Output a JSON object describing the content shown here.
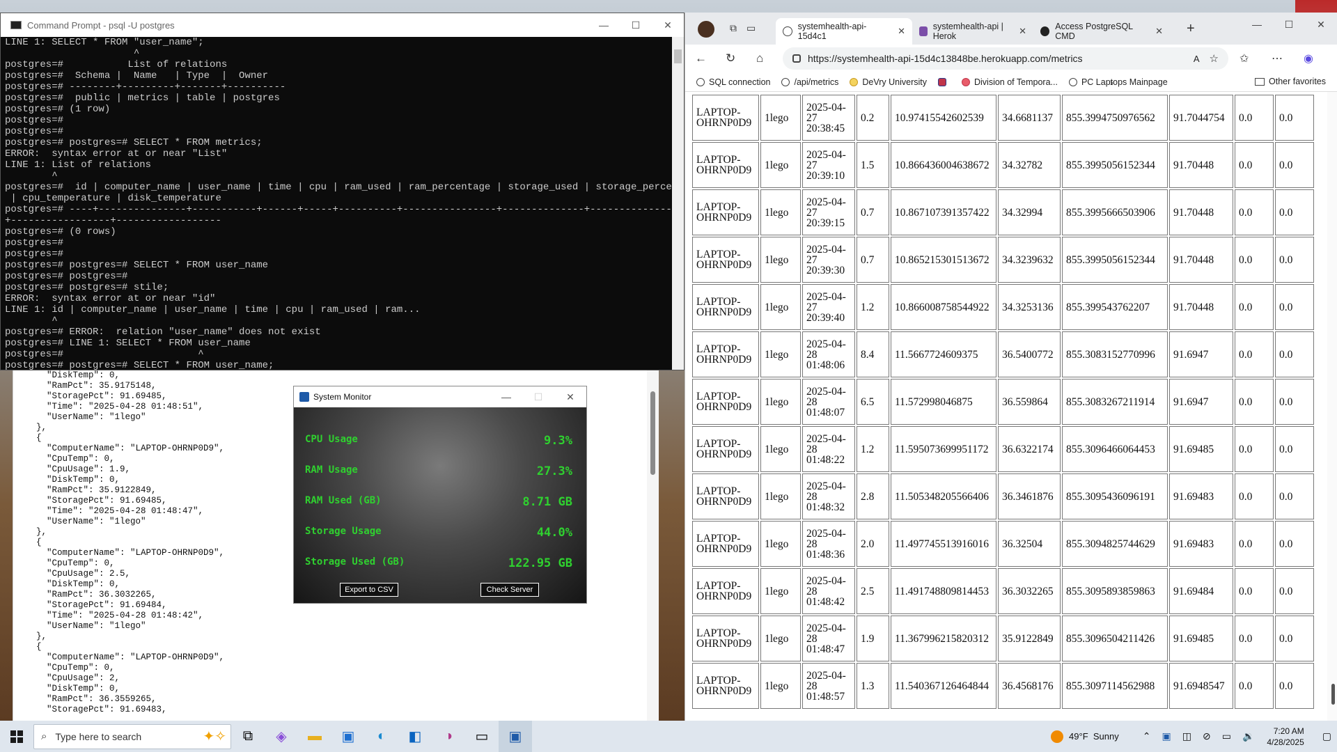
{
  "cmd": {
    "title": "Command Prompt - psql  -U postgres",
    "lines": [
      "LINE 1: SELECT * FROM \"user_name\";",
      "                      ^",
      "postgres=#           List of relations",
      "postgres=#  Schema |  Name   | Type  |  Owner",
      "postgres=# --------+---------+-------+----------",
      "postgres=#  public | metrics | table | postgres",
      "postgres=# (1 row)",
      "postgres=#",
      "postgres=#",
      "postgres=# postgres=# SELECT * FROM metrics;",
      "ERROR:  syntax error at or near \"List\"",
      "LINE 1: List of relations",
      "        ^",
      "postgres=#  id | computer_name | user_name | time | cpu | ram_used | ram_percentage | storage_used | storage_percentage",
      " | cpu_temperature | disk_temperature",
      "postgres=# ----+---------------+-----------+------+-----+----------+----------------+--------------+--------------------",
      "+-----------------+------------------",
      "postgres=# (0 rows)",
      "postgres=#",
      "postgres=#",
      "postgres=# postgres=# SELECT * FROM user_name",
      "postgres=# postgres=#",
      "postgres=# postgres=# stile;",
      "ERROR:  syntax error at or near \"id\"",
      "LINE 1: id | computer_name | user_name | time | cpu | ram_used | ram...",
      "        ^",
      "postgres=# ERROR:  relation \"user_name\" does not exist",
      "postgres=# LINE 1: SELECT * FROM user_name",
      "postgres=#                       ^",
      "postgres=# postgres=# SELECT * FROM user_name;"
    ]
  },
  "json_viewer": {
    "lines": [
      "    \"DiskTemp\": 0,",
      "    \"RamPct\": 35.9175148,",
      "    \"StoragePct\": 91.69485,",
      "    \"Time\": \"2025-04-28 01:48:51\",",
      "    \"UserName\": \"1lego\"",
      "  },",
      "  {",
      "    \"ComputerName\": \"LAPTOP-OHRNP0D9\",",
      "    \"CpuTemp\": 0,",
      "    \"CpuUsage\": 1.9,",
      "    \"DiskTemp\": 0,",
      "    \"RamPct\": 35.9122849,",
      "    \"StoragePct\": 91.69485,",
      "    \"Time\": \"2025-04-28 01:48:47\",",
      "    \"UserName\": \"1lego\"",
      "  },",
      "  {",
      "    \"ComputerName\": \"LAPTOP-OHRNP0D9\",",
      "    \"CpuTemp\": 0,",
      "    \"CpuUsage\": 2.5,",
      "    \"DiskTemp\": 0,",
      "    \"RamPct\": 36.3032265,",
      "    \"StoragePct\": 91.69484,",
      "    \"Time\": \"2025-04-28 01:48:42\",",
      "    \"UserName\": \"1lego\"",
      "  },",
      "  {",
      "    \"ComputerName\": \"LAPTOP-OHRNP0D9\",",
      "    \"CpuTemp\": 0,",
      "    \"CpuUsage\": 2,",
      "    \"DiskTemp\": 0,",
      "    \"RamPct\": 36.3559265,",
      "    \"StoragePct\": 91.69483,"
    ]
  },
  "system_monitor": {
    "title": "System Monitor",
    "metrics": [
      {
        "label": "CPU Usage",
        "value": "9.3%"
      },
      {
        "label": "RAM Usage",
        "value": "27.3%"
      },
      {
        "label": "RAM Used (GB)",
        "value": "8.71 GB"
      },
      {
        "label": "Storage Usage",
        "value": "44.0%"
      },
      {
        "label": "Storage Used (GB)",
        "value": "122.95 GB"
      }
    ],
    "export_label": "Export to CSV",
    "check_label": "Check Server"
  },
  "browser": {
    "tabs": [
      {
        "label": "systemhealth-api-15d4c1",
        "active": true
      },
      {
        "label": "systemhealth-api | Herok",
        "active": false
      },
      {
        "label": "Access PostgreSQL CMD",
        "active": false
      }
    ],
    "url": "https://systemhealth-api-15d4c13848be.herokuapp.com/metrics",
    "favorites": [
      "SQL connection",
      "/api/metrics",
      "DeVry University",
      "",
      "Division of Tempora...",
      "PC Laptops Mainpage"
    ],
    "other_favorites": "Other favorites",
    "rows": [
      [
        "LAPTOP-OHRNP0D9",
        "1lego",
        "2025-04-27 20:38:45",
        "0.2",
        "10.97415542602539",
        "34.6681137",
        "855.3994750976562",
        "91.7044754",
        "0.0",
        "0.0"
      ],
      [
        "LAPTOP-OHRNP0D9",
        "1lego",
        "2025-04-27 20:39:10",
        "1.5",
        "10.866436004638672",
        "34.32782",
        "855.3995056152344",
        "91.70448",
        "0.0",
        "0.0"
      ],
      [
        "LAPTOP-OHRNP0D9",
        "1lego",
        "2025-04-27 20:39:15",
        "0.7",
        "10.867107391357422",
        "34.32994",
        "855.3995666503906",
        "91.70448",
        "0.0",
        "0.0"
      ],
      [
        "LAPTOP-OHRNP0D9",
        "1lego",
        "2025-04-27 20:39:30",
        "0.7",
        "10.865215301513672",
        "34.3239632",
        "855.3995056152344",
        "91.70448",
        "0.0",
        "0.0"
      ],
      [
        "LAPTOP-OHRNP0D9",
        "1lego",
        "2025-04-27 20:39:40",
        "1.2",
        "10.866008758544922",
        "34.3253136",
        "855.399543762207",
        "91.70448",
        "0.0",
        "0.0"
      ],
      [
        "LAPTOP-OHRNP0D9",
        "1lego",
        "2025-04-28 01:48:06",
        "8.4",
        "11.5667724609375",
        "36.5400772",
        "855.3083152770996",
        "91.6947",
        "0.0",
        "0.0"
      ],
      [
        "LAPTOP-OHRNP0D9",
        "1lego",
        "2025-04-28 01:48:07",
        "6.5",
        "11.572998046875",
        "36.559864",
        "855.3083267211914",
        "91.6947",
        "0.0",
        "0.0"
      ],
      [
        "LAPTOP-OHRNP0D9",
        "1lego",
        "2025-04-28 01:48:22",
        "1.2",
        "11.595073699951172",
        "36.6322174",
        "855.3096466064453",
        "91.69485",
        "0.0",
        "0.0"
      ],
      [
        "LAPTOP-OHRNP0D9",
        "1lego",
        "2025-04-28 01:48:32",
        "2.8",
        "11.505348205566406",
        "36.3461876",
        "855.3095436096191",
        "91.69483",
        "0.0",
        "0.0"
      ],
      [
        "LAPTOP-OHRNP0D9",
        "1lego",
        "2025-04-28 01:48:36",
        "2.0",
        "11.497745513916016",
        "36.32504",
        "855.3094825744629",
        "91.69483",
        "0.0",
        "0.0"
      ],
      [
        "LAPTOP-OHRNP0D9",
        "1lego",
        "2025-04-28 01:48:42",
        "2.5",
        "11.491748809814453",
        "36.3032265",
        "855.3095893859863",
        "91.69484",
        "0.0",
        "0.0"
      ],
      [
        "LAPTOP-OHRNP0D9",
        "1lego",
        "2025-04-28 01:48:47",
        "1.9",
        "11.367996215820312",
        "35.9122849",
        "855.3096504211426",
        "91.69485",
        "0.0",
        "0.0"
      ],
      [
        "LAPTOP-OHRNP0D9",
        "1lego",
        "2025-04-28 01:48:57",
        "1.3",
        "11.540367126464844",
        "36.4568176",
        "855.3097114562988",
        "91.6948547",
        "0.0",
        "0.0"
      ]
    ]
  },
  "taskbar": {
    "search_placeholder": "Type here to search",
    "weather_temp": "49°F",
    "weather_desc": "Sunny",
    "time": "7:20 AM",
    "date": "4/28/2025"
  }
}
